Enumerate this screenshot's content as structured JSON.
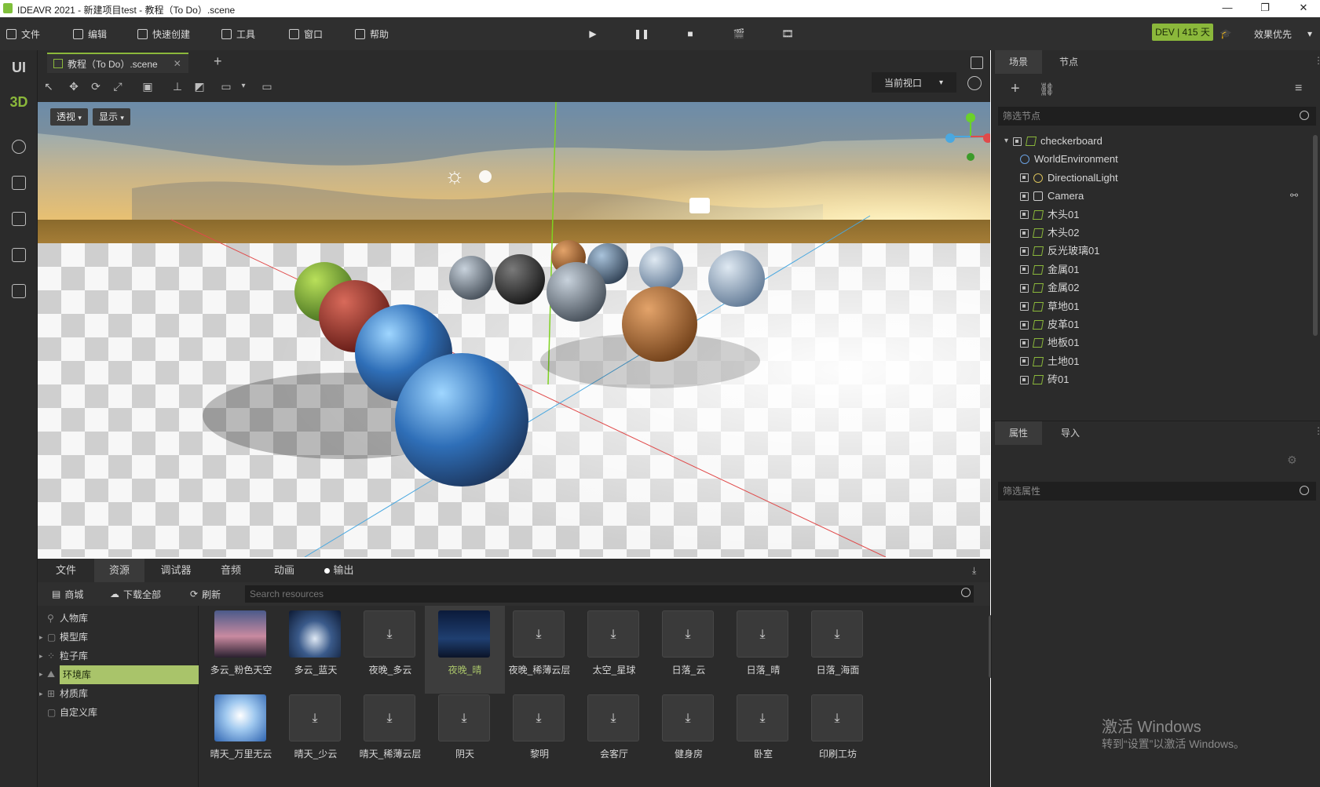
{
  "window": {
    "title": "IDEAVR 2021 - 新建项目test - 教程（To Do）.scene",
    "minimize": "—",
    "maximize": "❐",
    "close": "✕"
  },
  "menu": {
    "items": [
      "文件",
      "编辑",
      "快速创建",
      "工具",
      "窗口",
      "帮助"
    ],
    "dev_badge": "DEV | 415 天",
    "priority": "效果优先"
  },
  "rail": {
    "ui": "UI",
    "three_d": "3D"
  },
  "editor": {
    "tab_label": "教程（To Do）.scene",
    "add_tab": "+",
    "viewport_select": "当前视口",
    "perspective_btn": "透视",
    "display_btn": "显示"
  },
  "bottom": {
    "tabs": [
      "文件",
      "资源",
      "调试器",
      "音频",
      "动画",
      "输出"
    ],
    "active_tab": "资源",
    "toolbar": {
      "store": "商城",
      "download_all": "下载全部",
      "refresh": "刷新"
    },
    "search_placeholder": "Search resources",
    "library": [
      "人物库",
      "模型库",
      "粒子库",
      "环境库",
      "材质库",
      "自定义库"
    ],
    "selected_library": "环境库",
    "resources": [
      {
        "label": "多云_粉色天空",
        "type": "sky-pink"
      },
      {
        "label": "多云_蓝天",
        "type": "sky-blue"
      },
      {
        "label": "夜晚_多云",
        "type": "download"
      },
      {
        "label": "夜晚_晴",
        "type": "sky-night",
        "selected": true
      },
      {
        "label": "夜晚_稀薄云层",
        "type": "download"
      },
      {
        "label": "太空_星球",
        "type": "download"
      },
      {
        "label": "日落_云",
        "type": "download"
      },
      {
        "label": "日落_晴",
        "type": "download"
      },
      {
        "label": "日落_海面",
        "type": "download"
      },
      {
        "label": "晴天_万里无云",
        "type": "sky-clear"
      },
      {
        "label": "晴天_少云",
        "type": "download"
      },
      {
        "label": "晴天_稀薄云层",
        "type": "download"
      },
      {
        "label": "阴天",
        "type": "download"
      },
      {
        "label": "黎明",
        "type": "download"
      },
      {
        "label": "会客厅",
        "type": "download"
      },
      {
        "label": "健身房",
        "type": "download"
      },
      {
        "label": "卧室",
        "type": "download"
      },
      {
        "label": "印刷工坊",
        "type": "download"
      }
    ]
  },
  "right": {
    "scene_tabs": [
      "场景",
      "节点"
    ],
    "filter_nodes": "筛选节点",
    "nodes": [
      {
        "name": "checkerboard",
        "icon": "mesh",
        "depth": 0
      },
      {
        "name": "WorldEnvironment",
        "icon": "globe",
        "depth": 1
      },
      {
        "name": "DirectionalLight",
        "icon": "sun",
        "depth": 1
      },
      {
        "name": "Camera",
        "icon": "camera",
        "depth": 1
      },
      {
        "name": "木头01",
        "icon": "mesh",
        "depth": 1
      },
      {
        "name": "木头02",
        "icon": "mesh",
        "depth": 1
      },
      {
        "name": "反光玻璃01",
        "icon": "mesh",
        "depth": 1
      },
      {
        "name": "金属01",
        "icon": "mesh",
        "depth": 1
      },
      {
        "name": "金属02",
        "icon": "mesh",
        "depth": 1
      },
      {
        "name": "草地01",
        "icon": "mesh",
        "depth": 1
      },
      {
        "name": "皮革01",
        "icon": "mesh",
        "depth": 1
      },
      {
        "name": "地板01",
        "icon": "mesh",
        "depth": 1
      },
      {
        "name": "土地01",
        "icon": "mesh",
        "depth": 1
      },
      {
        "name": "砖01",
        "icon": "mesh",
        "depth": 1
      }
    ],
    "prop_tabs": [
      "属性",
      "导入"
    ],
    "filter_props": "筛选属性",
    "watermark_title": "激活 Windows",
    "watermark_sub": "转到“设置”以激活 Windows。"
  },
  "colors": {
    "accent": "#8bb83b",
    "panel": "#2b2b2b",
    "menubar": "#2f2f2f"
  }
}
